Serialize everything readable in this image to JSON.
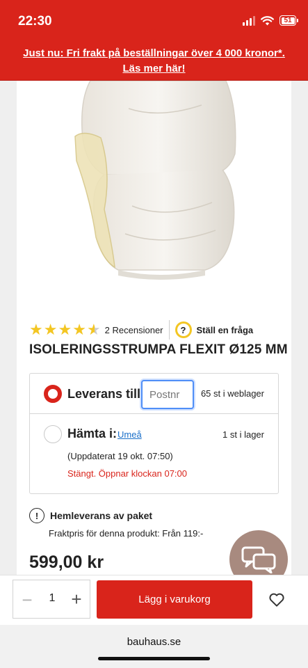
{
  "status_bar": {
    "time": "22:30",
    "battery": "51"
  },
  "promo": {
    "line1": "Just nu: Fri frakt på beställningar över 4 000 kronor*.",
    "line2": "Läs mer här!"
  },
  "product": {
    "rating": 4.5,
    "reviews_label": "2 Recensioner",
    "ask_question_label": "Ställ en fråga",
    "title": "ISOLERINGSSTRUMPA FLEXIT Ø125 MM",
    "price": "599,00 kr"
  },
  "delivery": {
    "delivery_label": "Leverans till:",
    "postnr_placeholder": "Postnr",
    "online_stock": "65 st i weblager",
    "pickup_label": "Hämta i:",
    "store_name": "Umeå",
    "store_stock": "1 st i lager",
    "updated": "(Uppdaterat 19 okt. 07:50)",
    "store_status": "Stängt. Öppnar klockan 07:00"
  },
  "home_delivery": {
    "label": "Hemleverans av paket",
    "freight": "Fraktpris för denna produkt: Från 119:-"
  },
  "cart": {
    "quantity": "1",
    "add_label": "Lägg i varukorg"
  },
  "browser": {
    "url": "bauhaus.se"
  },
  "colors": {
    "brand_red": "#d9241b",
    "star_yellow": "#f3c623",
    "link_blue": "#1a6fc9",
    "chat_bubble": "#a88a7f"
  }
}
